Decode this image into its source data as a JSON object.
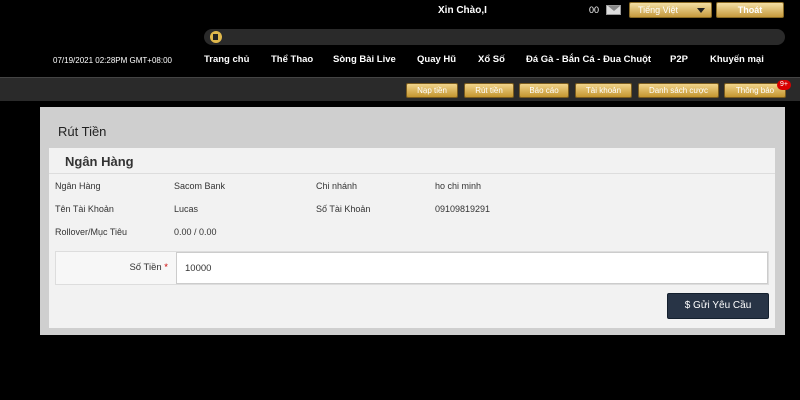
{
  "header": {
    "greeting": "Xin Chào,I",
    "balance": "00",
    "language": "Tiếng Việt",
    "logout": "Thoát"
  },
  "nav": {
    "datetime": "07/19/2021 02:28PM GMT+08:00",
    "items": [
      "Trang chủ",
      "Thể Thao",
      "Sòng Bài Live",
      "Quay Hũ",
      "Xổ Số",
      "Đá Gà - Bắn Cá - Đua Chuột",
      "P2P",
      "Khuyến mại"
    ]
  },
  "account_menu": {
    "items": [
      "Nạp tiền",
      "Rút tiền",
      "Báo cáo",
      "Tài khoản",
      "Danh sách cược",
      "Thông báo"
    ],
    "notify_badge": "9+"
  },
  "withdraw": {
    "title": "Rút Tiền",
    "section_title": "Ngân Hàng",
    "bank_label": "Ngân Hàng",
    "bank_value": "Sacom Bank",
    "branch_label": "Chi nhánh",
    "branch_value": "ho chi minh",
    "account_name_label": "Tên Tài Khoản",
    "account_name_value": "Lucas",
    "account_number_label": "Số Tài Khoản",
    "account_number_value": "09109819291",
    "rollover_label": "Rollover/Mục Tiêu",
    "rollover_value": "0.00 / 0.00",
    "amount_label": "Số Tiền",
    "amount_required": "*",
    "amount_value": "10000",
    "submit_label": "$ Gửi Yêu Cầu"
  }
}
